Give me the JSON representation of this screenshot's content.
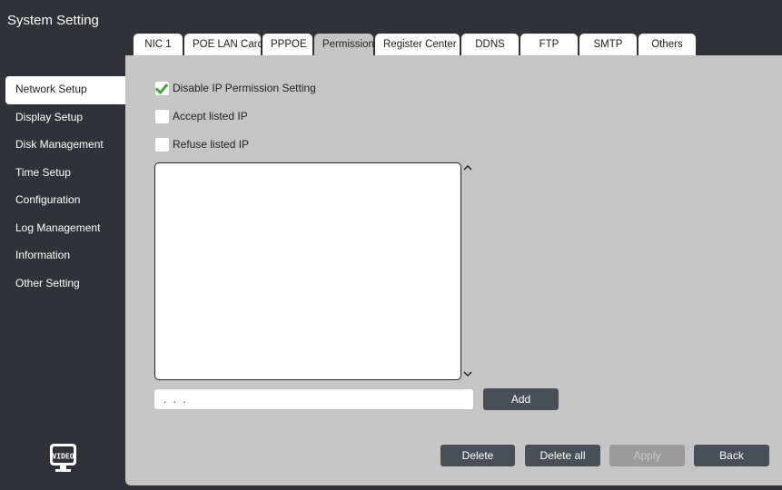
{
  "app": {
    "title": "System Setting"
  },
  "tabs": [
    {
      "label": "NIC 1",
      "active": false
    },
    {
      "label": "POE LAN Card",
      "active": false
    },
    {
      "label": "PPPOE",
      "active": false
    },
    {
      "label": "Permission",
      "active": true
    },
    {
      "label": "Register Center",
      "active": false
    },
    {
      "label": "DDNS",
      "active": false
    },
    {
      "label": "FTP",
      "active": false
    },
    {
      "label": "SMTP",
      "active": false
    },
    {
      "label": "Others",
      "active": false
    }
  ],
  "sidebar": {
    "items": [
      {
        "label": "Network Setup",
        "active": true
      },
      {
        "label": "Display Setup",
        "active": false
      },
      {
        "label": "Disk Management",
        "active": false
      },
      {
        "label": "Time Setup",
        "active": false
      },
      {
        "label": "Configuration",
        "active": false
      },
      {
        "label": "Log Management",
        "active": false
      },
      {
        "label": "Information",
        "active": false
      },
      {
        "label": "Other Setting",
        "active": false
      }
    ],
    "logo_text": "VIDEO"
  },
  "permission": {
    "options": [
      {
        "label": "Disable IP Permission Setting",
        "checked": true
      },
      {
        "label": "Accept listed IP",
        "checked": false
      },
      {
        "label": "Refuse listed IP",
        "checked": false
      }
    ],
    "ip_list": [],
    "ip_input_value": " .  .  .",
    "add_label": "Add"
  },
  "buttons": {
    "delete": "Delete",
    "delete_all": "Delete all",
    "apply": "Apply",
    "back": "Back"
  },
  "colors": {
    "background": "#2f3339",
    "panel": "#c5c5c5",
    "button": "#494f57",
    "check": "#3ea83a"
  }
}
